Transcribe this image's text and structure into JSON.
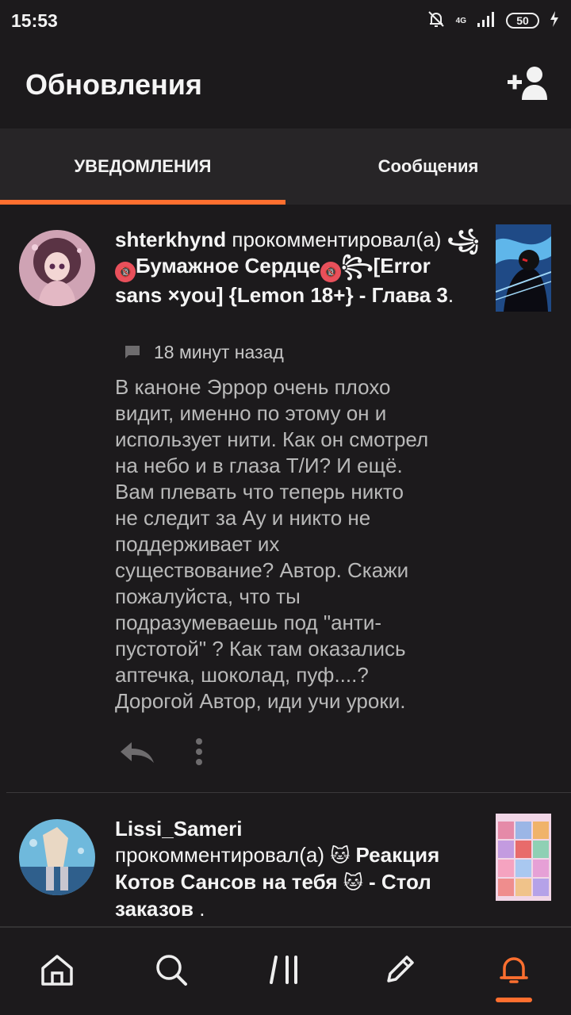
{
  "status_bar": {
    "time": "15:53",
    "network": "4G",
    "battery": "50"
  },
  "header": {
    "title": "Обновления"
  },
  "tabs": [
    {
      "label": "УВЕДОМЛЕНИЯ",
      "active": true
    },
    {
      "label": "Сообщения",
      "active": false
    }
  ],
  "notifications": [
    {
      "user": "shterkhynd",
      "action": "прокомментировал(а)",
      "work_swirl": "꧁",
      "work_badge": "🔞",
      "work_part1": "Бумажное Сердце",
      "work_badge2": "🔞",
      "work_swirl2": "꧂",
      "work_part2": "[Error sans ×you] {Lemon 18+}",
      "separator": " - ",
      "chapter": "Глава 3",
      "period": ".",
      "time_ago": "18 минут назад",
      "comment": "В каноне Эррор очень плохо видит, именно по этому он и использует нити. Как он смотрел на небо и в глаза Т/И? И ещё. Вам плевать что теперь никто не следит за Ау и никто не поддерживает их существование? Автор. Скажи пожалуйста, что ты подразумеваешь под \"анти-пустотой\" ? Как там оказались аптечка, шоколад, пуф....? Дорогой Автор, иди учи уроки."
    },
    {
      "user": "Lissi_Sameri",
      "action": "прокомментировал(а)",
      "emoji": "🐱",
      "work": "Реакция Котов Сансов на тебя",
      "emoji2": "🐱",
      "separator": " - ",
      "chapter": "Стол заказов",
      "period": " ."
    }
  ],
  "bottom_nav": [
    {
      "icon": "home-icon",
      "active": false
    },
    {
      "icon": "search-icon",
      "active": false
    },
    {
      "icon": "library-icon",
      "active": false
    },
    {
      "icon": "pencil-icon",
      "active": false
    },
    {
      "icon": "bell-icon",
      "active": true
    }
  ],
  "colors": {
    "accent": "#ff6f2f",
    "background": "#1c1a1c",
    "tab_bar": "#272527"
  }
}
